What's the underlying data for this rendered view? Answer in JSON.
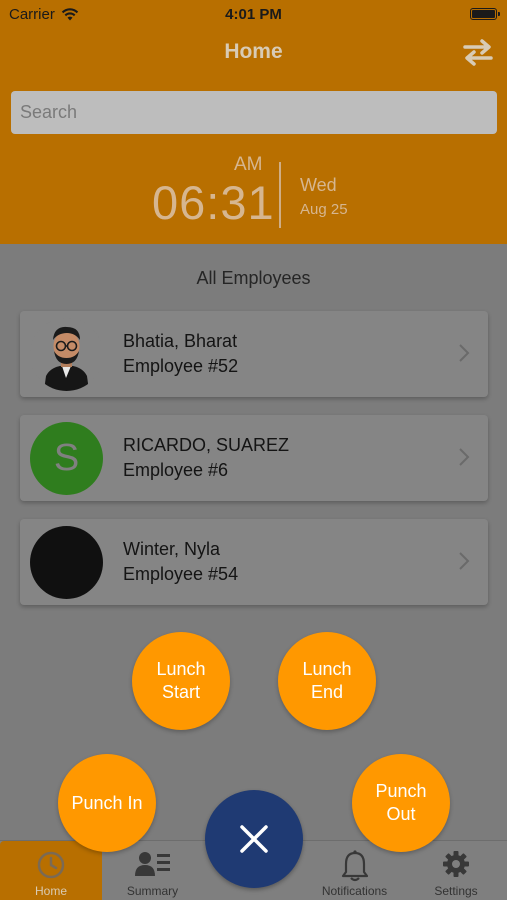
{
  "status_bar": {
    "carrier": "Carrier",
    "time": "4:01 PM"
  },
  "header": {
    "title": "Home",
    "switch_icon": "swap-arrows-icon",
    "search_placeholder": "Search",
    "clock": {
      "ampm": "AM",
      "time": "06:31",
      "day": "Wed",
      "date": "Aug 25"
    }
  },
  "list": {
    "title": "All Employees",
    "employees": [
      {
        "name": "Bhatia, Bharat",
        "number": "Employee #52",
        "avatar": "cartoon-photo"
      },
      {
        "name": "RICARDO, SUAREZ",
        "number": "Employee #6",
        "avatar": "letter",
        "initial": "S"
      },
      {
        "name": "Winter, Nyla",
        "number": "Employee #54",
        "avatar": "dark-photo"
      }
    ]
  },
  "actions": {
    "lunch_start": "Lunch Start",
    "lunch_end": "Lunch End",
    "punch_in": "Punch In",
    "punch_out": "Punch Out",
    "close_icon": "close-icon"
  },
  "tabs": [
    {
      "label": "Home",
      "icon": "clock-icon",
      "active": true
    },
    {
      "label": "Summary",
      "icon": "summary-icon",
      "active": false
    },
    {
      "label": "Notifications",
      "icon": "bell-icon",
      "active": false
    },
    {
      "label": "Settings",
      "icon": "gear-icon",
      "active": false
    }
  ],
  "colors": {
    "accent": "#ff9800",
    "header_dimmed": "#b86f00",
    "close_button": "#1f3a73",
    "overlay": "#7c7c7c"
  }
}
